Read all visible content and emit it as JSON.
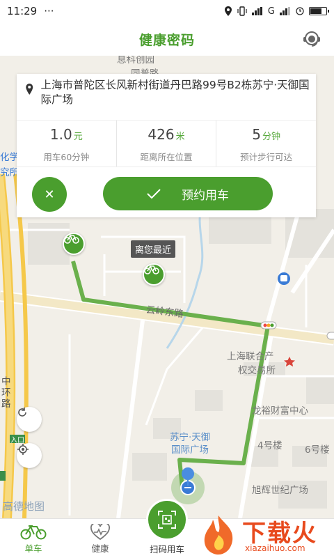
{
  "status_bar": {
    "time": "11:29",
    "dots": "···",
    "network": "G"
  },
  "app_bar": {
    "title": "健康密码"
  },
  "location_card": {
    "address": "上海市普陀区长风新村街道丹巴路99号B2栋苏宁·天御国际广场",
    "stats": [
      {
        "value": "1.0",
        "unit": "元",
        "label": "用车60分钟"
      },
      {
        "value": "426",
        "unit": "米",
        "label": "距离所在位置"
      },
      {
        "value": "5",
        "unit": "分钟",
        "label": "预计步行可达"
      }
    ],
    "cancel_symbol": "✕",
    "reserve_label": "预约用车"
  },
  "map": {
    "nearest_tag": "离您最近",
    "labels": {
      "road_yunling": "云岭东路",
      "exchange": "上海联合产权交易所",
      "exchange_line1": "上海联合产",
      "exchange_line2": "权交易所",
      "longyu": "龙裕财富中心",
      "suning_line1": "苏宁·天御",
      "suning_line2": "国际广场",
      "bldg4": "4号楼",
      "bldg6": "6号楼",
      "xuhui": "旭辉世纪广场",
      "zhonghuan": "中环路",
      "entrance": "入口",
      "huaxue": "化学",
      "research": "究所",
      "top_cut": "息科创园",
      "top_cut2": "同普路",
      "amap": "高德地图"
    },
    "colors": {
      "route": "#6ab04c",
      "road_main": "#f5d37a",
      "accent": "#4a9e2e"
    }
  },
  "bottom_nav": {
    "items": [
      {
        "label": "单车",
        "active": true
      },
      {
        "label": "健康",
        "active": false
      }
    ],
    "scan_label": "扫码用车"
  },
  "watermark": {
    "text": "下载火",
    "url": "xiazaihuo.com"
  }
}
